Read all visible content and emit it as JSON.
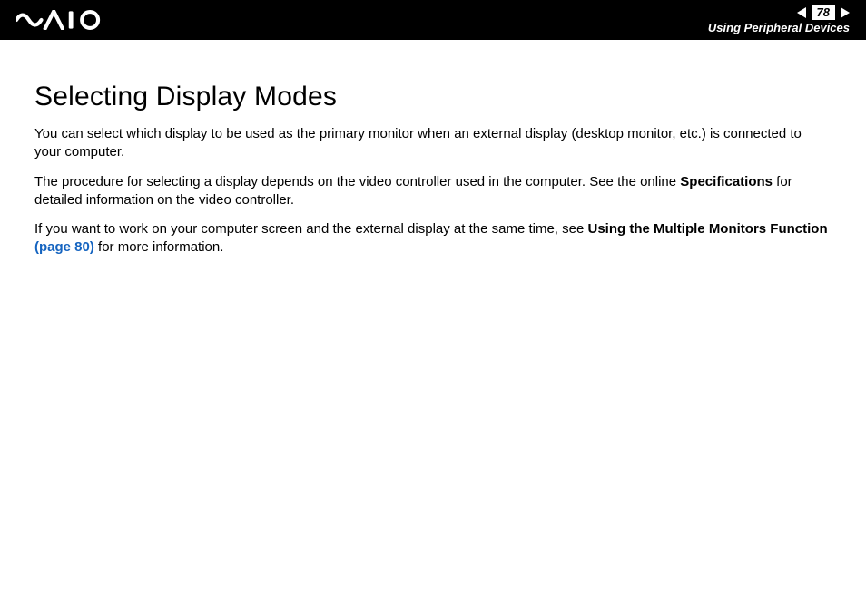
{
  "header": {
    "page_number": "78",
    "section": "Using Peripheral Devices"
  },
  "content": {
    "title": "Selecting Display Modes",
    "p1": "You can select which display to be used as the primary monitor when an external display (desktop monitor, etc.) is connected to your computer.",
    "p2a": "The procedure for selecting a display depends on the video controller used in the computer. See the online ",
    "p2_bold": "Specifications",
    "p2b": " for detailed information on the video controller.",
    "p3a": "If you want to work on your computer screen and the external display at the same time, see ",
    "p3_bold": "Using the Multiple Monitors Function ",
    "p3_link": "(page 80)",
    "p3b": " for more information."
  }
}
